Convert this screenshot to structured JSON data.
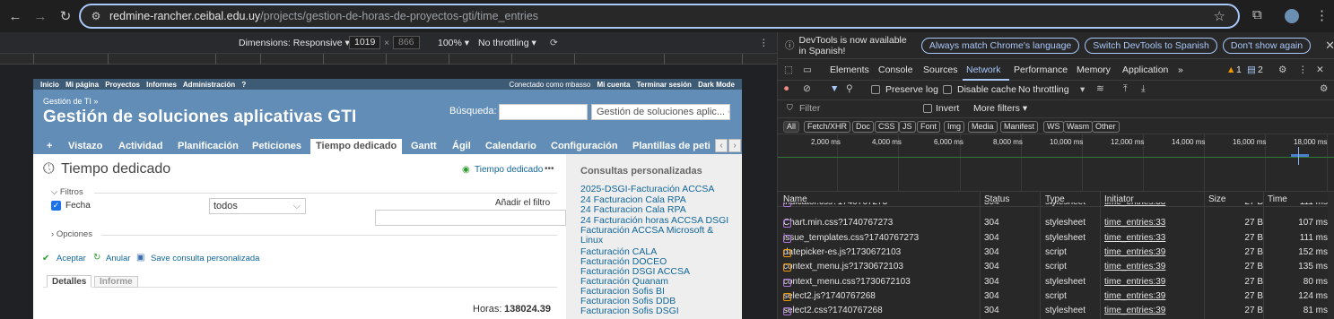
{
  "browser": {
    "url_host": "redmine-rancher.ceibal.edu.uy",
    "url_path": "/projects/gestion-de-horas-de-proyectos-gti/time_entries"
  },
  "device_toolbar": {
    "dimensions_label": "Dimensions: Responsive ▾",
    "width": "1019",
    "height": "866",
    "zoom": "100% ▾",
    "throttling": "No throttling ▾"
  },
  "redmine": {
    "top_menu_left": [
      "Inicio",
      "Mi página",
      "Proyectos",
      "Informes",
      "Administración",
      "?"
    ],
    "logged_as": "Conectado como mbasso",
    "top_menu_right": [
      "Mi cuenta",
      "Terminar sesión",
      "Dark Mode"
    ],
    "breadcrumb": "Gestión de TI »",
    "project_title": "Gestión de soluciones aplicativas GTI",
    "search_label": "Búsqueda:",
    "project_jump": "Gestión de soluciones aplic... ⌵",
    "tabs": [
      "+",
      "Vistazo",
      "Actividad",
      "Planificación",
      "Peticiones",
      "Tiempo dedicado",
      "Gantt",
      "Ágil",
      "Calendario",
      "Configuración",
      "Plantillas de peti"
    ],
    "page_title": "Tiempo dedicado",
    "context_link": "Tiempo dedicado",
    "more": "•••",
    "filters_label": "Filtros",
    "filter_field": "Fecha",
    "filter_value": "todos",
    "add_filter_label": "Añadir el filtro",
    "options_label": "Opciones",
    "apply": "Aceptar",
    "clear": "Anular",
    "save_query": "Save consulta personalizada",
    "view_tabs": [
      "Detalles",
      "Informe"
    ],
    "hours_label": "Horas:",
    "hours_value": "138024.39",
    "sidebar_title": "Consultas personalizadas",
    "sidebar_queries": [
      "2025-DSGI-Facturación ACCSA",
      "24 Facturacion Cala RPA",
      "24 Facturacion Cala RPA",
      "24 Facturación horas ACCSA DSGI",
      "Facturación ACCSA Microsoft &",
      "Linux",
      "Facturación CALA",
      "Facturación DOCEO",
      "Facturación DSGI ACCSA",
      "Facturación Quanam",
      "Facturacion Sofis BI",
      "Facturacion Sofis DDB",
      "Facturacion Sofis DSGI"
    ]
  },
  "devtools": {
    "info": "DevTools is now available in Spanish!",
    "btn_match": "Always match Chrome's language",
    "btn_switch": "Switch DevTools to Spanish",
    "btn_dont_show": "Don't show again",
    "tabs": [
      "Elements",
      "Console",
      "Sources",
      "Network",
      "Performance",
      "Memory",
      "Application",
      "»"
    ],
    "warnings": "1",
    "messages": "2",
    "preserve_log": "Preserve log",
    "disable_cache": "Disable cache",
    "throttling": "No throttling",
    "filter_placeholder": "Filter",
    "invert": "Invert",
    "more_filters": "More filters ▾",
    "type_filters": [
      "All",
      "Fetch/XHR",
      "Doc",
      "CSS",
      "JS",
      "Font",
      "Img",
      "Media",
      "Manifest",
      "WS",
      "Wasm",
      "Other"
    ],
    "timeline_ticks": [
      "2,000 ms",
      "4,000 ms",
      "6,000 ms",
      "8,000 ms",
      "10,000 ms",
      "12,000 ms",
      "14,000 ms",
      "16,000 ms",
      "18,000 ms"
    ],
    "columns": [
      "Name",
      "Status",
      "Type",
      "Initiator",
      "Size",
      "Time"
    ],
    "rows": [
      {
        "name": "indicator.css?1740767273",
        "status": "304",
        "type": "stylesheet",
        "initiator": "time_entries:33",
        "size": "27 B",
        "time": "111 ms",
        "kind": "css"
      },
      {
        "name": "Chart.min.css?1740767273",
        "status": "304",
        "type": "stylesheet",
        "initiator": "time_entries:33",
        "size": "27 B",
        "time": "107 ms",
        "kind": "css"
      },
      {
        "name": "issue_templates.css?1740767273",
        "status": "304",
        "type": "stylesheet",
        "initiator": "time_entries:33",
        "size": "27 B",
        "time": "111 ms",
        "kind": "css"
      },
      {
        "name": "datepicker-es.js?1730672103",
        "status": "304",
        "type": "script",
        "initiator": "time_entries:39",
        "size": "27 B",
        "time": "152 ms",
        "kind": "js"
      },
      {
        "name": "context_menu.js?1730672103",
        "status": "304",
        "type": "script",
        "initiator": "time_entries:39",
        "size": "27 B",
        "time": "135 ms",
        "kind": "js"
      },
      {
        "name": "context_menu.css?1730672103",
        "status": "304",
        "type": "stylesheet",
        "initiator": "time_entries:39",
        "size": "27 B",
        "time": "80 ms",
        "kind": "css"
      },
      {
        "name": "select2.js?1740767268",
        "status": "304",
        "type": "script",
        "initiator": "time_entries:39",
        "size": "27 B",
        "time": "124 ms",
        "kind": "js"
      },
      {
        "name": "select2.css?1740767268",
        "status": "304",
        "type": "stylesheet",
        "initiator": "time_entries:39",
        "size": "27 B",
        "time": "81 ms",
        "kind": "css"
      }
    ]
  },
  "colors": {
    "redmine_header": "#628db6",
    "redmine_top": "#3e5b76",
    "accent": "#a8c7fa",
    "css_icon": "#b073e0",
    "js_icon": "#f29900"
  }
}
